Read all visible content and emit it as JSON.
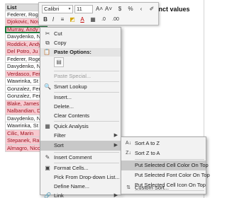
{
  "sheet": {
    "column_header": "List",
    "distinct_header": "inct values",
    "rows": [
      {
        "text": "Federer, Roge",
        "style": "plain"
      },
      {
        "text": "Djokovic, Novak",
        "style": "pink"
      },
      {
        "text": "Murray, Andy",
        "style": "pink-selected"
      },
      {
        "text": "Davydenko, N",
        "style": "plain"
      },
      {
        "text": "Roddick, Andy",
        "style": "pink"
      },
      {
        "text": "Del Potro, Ju",
        "style": "pink"
      },
      {
        "text": "Federer, Roge",
        "style": "plain"
      },
      {
        "text": "Davydenko, N",
        "style": "plain"
      },
      {
        "text": "Verdasco, Fer",
        "style": "pink"
      },
      {
        "text": "Wawrinka, St",
        "style": "plain"
      },
      {
        "text": "Gonzalez, Fer",
        "style": "plain"
      },
      {
        "text": "Gonzalez, Fer",
        "style": "plain"
      },
      {
        "text": "Blake, James",
        "style": "pink"
      },
      {
        "text": "Nalbandian, D",
        "style": "pink"
      },
      {
        "text": "Davydenko, N",
        "style": "plain"
      },
      {
        "text": "Wawrinka, St",
        "style": "plain"
      },
      {
        "text": "Cilic, Marin",
        "style": "pink"
      },
      {
        "text": "Stepanek, Ra",
        "style": "pink"
      },
      {
        "text": "Almagro, Nico",
        "style": "pink"
      }
    ]
  },
  "mini_toolbar": {
    "font_name": "Calibri",
    "font_size": "11",
    "grow_font": "A˄",
    "shrink_font": "A˅",
    "currency": "$",
    "percent": "%",
    "comma": "‹",
    "bold": "B",
    "italic": "I",
    "align": "≡",
    "fill": "◩",
    "font_color": "A",
    "borders": "▦",
    "inc_decimal": ".0",
    "dec_decimal": ".00",
    "format_painter": "✐"
  },
  "context_menu": {
    "cut": "Cut",
    "copy": "Copy",
    "paste_options": "Paste Options:",
    "paste_special": "Paste Special...",
    "smart_lookup": "Smart Lookup",
    "insert": "Insert...",
    "delete": "Delete...",
    "clear_contents": "Clear Contents",
    "quick_analysis": "Quick Analysis",
    "filter": "Filter",
    "sort": "Sort",
    "insert_comment": "Insert Comment",
    "format_cells": "Format Cells...",
    "pick_dropdown": "Pick From Drop-down List...",
    "define_name": "Define Name...",
    "link": "Link"
  },
  "sort_submenu": {
    "a_to_z": "Sort A to Z",
    "z_to_a": "Sort Z to A",
    "cell_color": "Put Selected Cell Color On Top",
    "font_color": "Put Selected Font Color On Top",
    "cell_icon": "Put Selected Cell Icon On Top",
    "custom_sort": "Custom Sort..."
  },
  "colors": {
    "pink_fill": "#f8c9cf",
    "pink_text": "#9a0f1d",
    "selection": "#1f7a3f",
    "menu_bg": "#f2f2f2",
    "menu_highlight": "#c8c8c8"
  }
}
